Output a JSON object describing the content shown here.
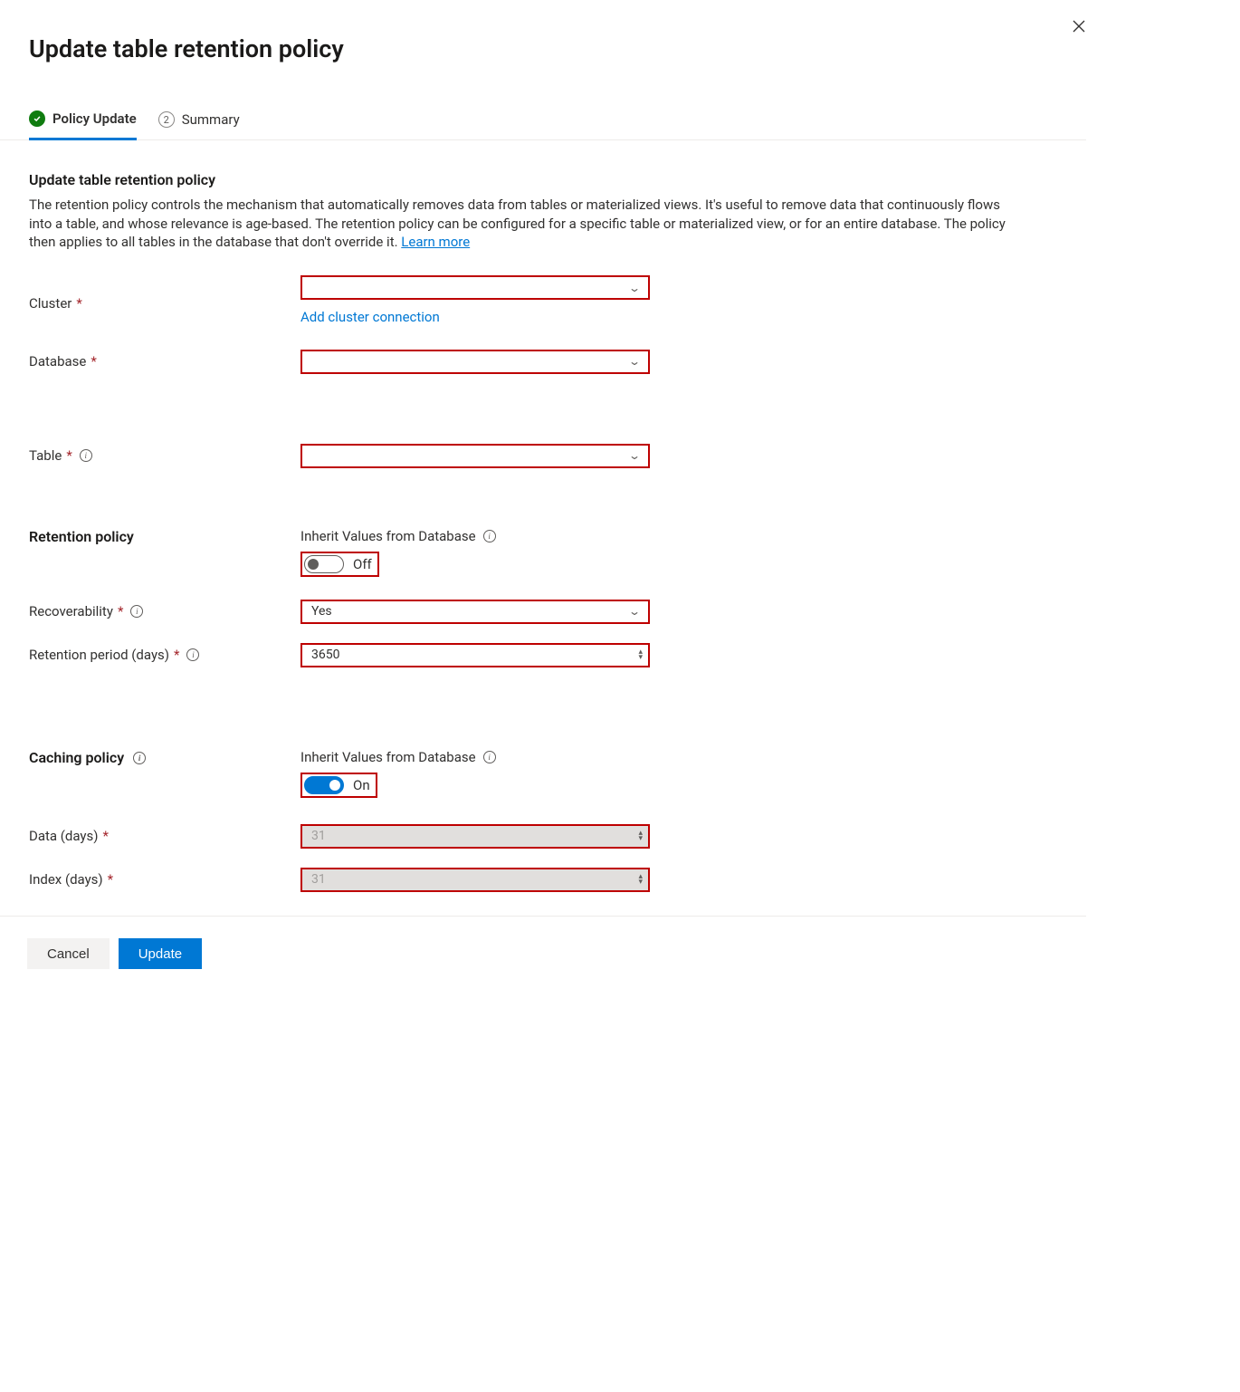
{
  "header": {
    "title": "Update table retention policy"
  },
  "tabs": {
    "policy_update": "Policy Update",
    "summary_index": "2",
    "summary": "Summary"
  },
  "section": {
    "title": "Update table retention policy",
    "desc_1": "The retention policy controls the mechanism that automatically removes data from tables or materialized views. It's useful to remove data that continuously flows into a table, and whose relevance is age-based. The retention policy can be configured for a specific table or materialized view, or for an entire database. The policy then applies to all tables in the database that don't override it. ",
    "learn_more": "Learn more"
  },
  "fields": {
    "cluster_label": "Cluster",
    "cluster_value": "",
    "add_cluster_link": "Add cluster connection",
    "database_label": "Database",
    "database_value": "",
    "table_label": "Table",
    "table_value": ""
  },
  "retention": {
    "heading": "Retention policy",
    "inherit_label": "Inherit Values from Database",
    "inherit_state_text": "Off",
    "recoverability_label": "Recoverability",
    "recoverability_value": "Yes",
    "period_label": "Retention period (days)",
    "period_value": "3650"
  },
  "caching": {
    "heading": "Caching policy",
    "inherit_label": "Inherit Values from Database",
    "inherit_state_text": "On",
    "data_label": "Data (days)",
    "data_value": "31",
    "index_label": "Index (days)",
    "index_value": "31"
  },
  "footer": {
    "cancel": "Cancel",
    "update": "Update"
  }
}
